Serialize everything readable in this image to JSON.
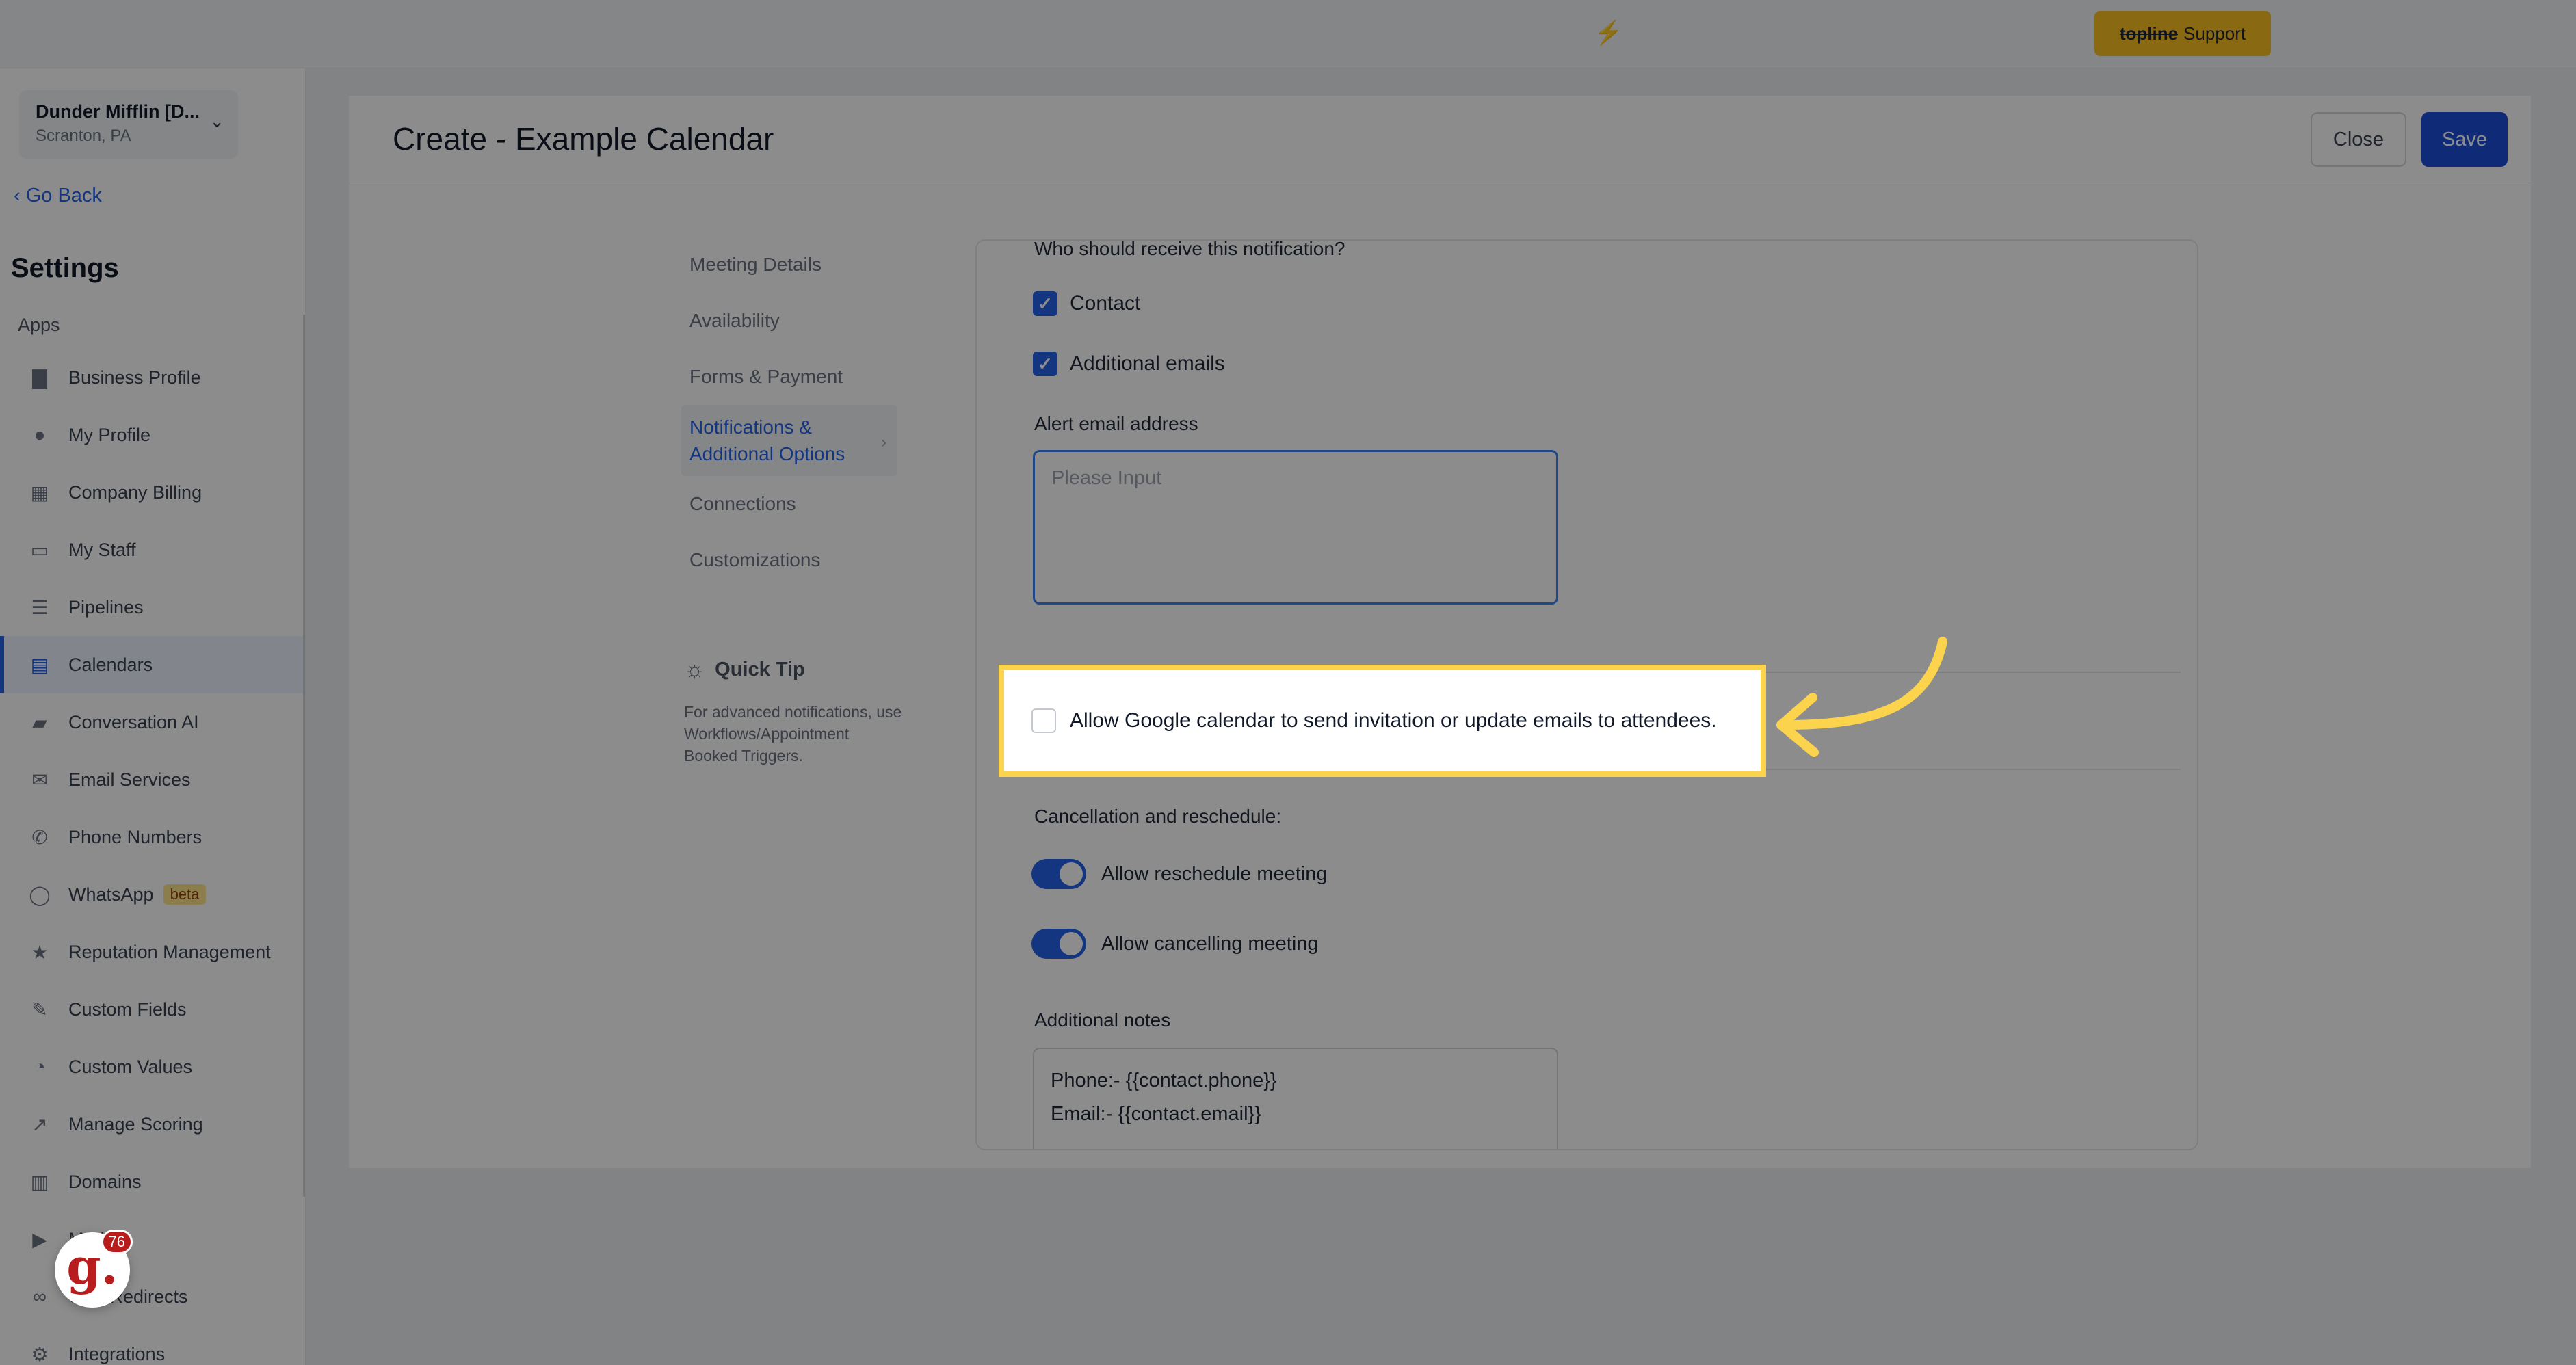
{
  "topbar": {
    "bolt_icon": "lightning-bolt-icon",
    "support": {
      "strike": "topline",
      "label": "Support"
    }
  },
  "sidebar": {
    "account": {
      "name": "Dunder Mifflin [D...",
      "location": "Scranton, PA"
    },
    "go_back": "Go Back",
    "title": "Settings",
    "section": "Apps",
    "items": [
      {
        "label": "Business Profile",
        "icon": "briefcase-icon"
      },
      {
        "label": "My Profile",
        "icon": "user-icon"
      },
      {
        "label": "Company Billing",
        "icon": "grid-icon"
      },
      {
        "label": "My Staff",
        "icon": "id-card-icon"
      },
      {
        "label": "Pipelines",
        "icon": "filter-icon"
      },
      {
        "label": "Calendars",
        "icon": "calendar-icon"
      },
      {
        "label": "Conversation AI",
        "icon": "chat-icon"
      },
      {
        "label": "Email Services",
        "icon": "mail-icon"
      },
      {
        "label": "Phone Numbers",
        "icon": "phone-icon"
      },
      {
        "label": "WhatsApp",
        "icon": "whatsapp-icon",
        "badge": "beta"
      },
      {
        "label": "Reputation Management",
        "icon": "star-icon"
      },
      {
        "label": "Custom Fields",
        "icon": "edit-icon"
      },
      {
        "label": "Custom Values",
        "icon": "pie-icon"
      },
      {
        "label": "Manage Scoring",
        "icon": "chart-icon"
      },
      {
        "label": "Domains",
        "icon": "server-icon"
      },
      {
        "label": "Media",
        "icon": "video-icon"
      },
      {
        "label": "URL Redirects",
        "icon": "link-icon"
      },
      {
        "label": "Integrations",
        "icon": "integrations-icon"
      }
    ],
    "fab": {
      "letter": "g.",
      "count": "76"
    }
  },
  "header": {
    "title": "Create - Example Calendar",
    "close": "Close",
    "save": "Save"
  },
  "subnav": {
    "items": [
      "Meeting Details",
      "Availability",
      "Forms & Payment"
    ],
    "active": "Notifications & Additional Options",
    "after": [
      "Connections",
      "Customizations"
    ]
  },
  "quick_tip": {
    "title": "Quick Tip",
    "text": "For advanced notifications, use Workflows/Appointment Booked Triggers."
  },
  "form": {
    "recipients_label": "Who should receive this notification?",
    "contact": "Contact",
    "additional_emails": "Additional emails",
    "alert_label": "Alert email address",
    "alert_placeholder": "Please Input",
    "google_allow": "Allow Google calendar to send invitation or update emails to attendees.",
    "cancel_label": "Cancellation and reschedule:",
    "allow_reschedule": "Allow reschedule meeting",
    "allow_cancel": "Allow cancelling meeting",
    "notes_label": "Additional notes",
    "notes_line1": "Phone:- {{contact.phone}}",
    "notes_line2": "Email:- {{contact.email}}"
  },
  "colors": {
    "accent": "#2563eb",
    "highlight": "#fcd34d",
    "support": "#fbbf24"
  }
}
